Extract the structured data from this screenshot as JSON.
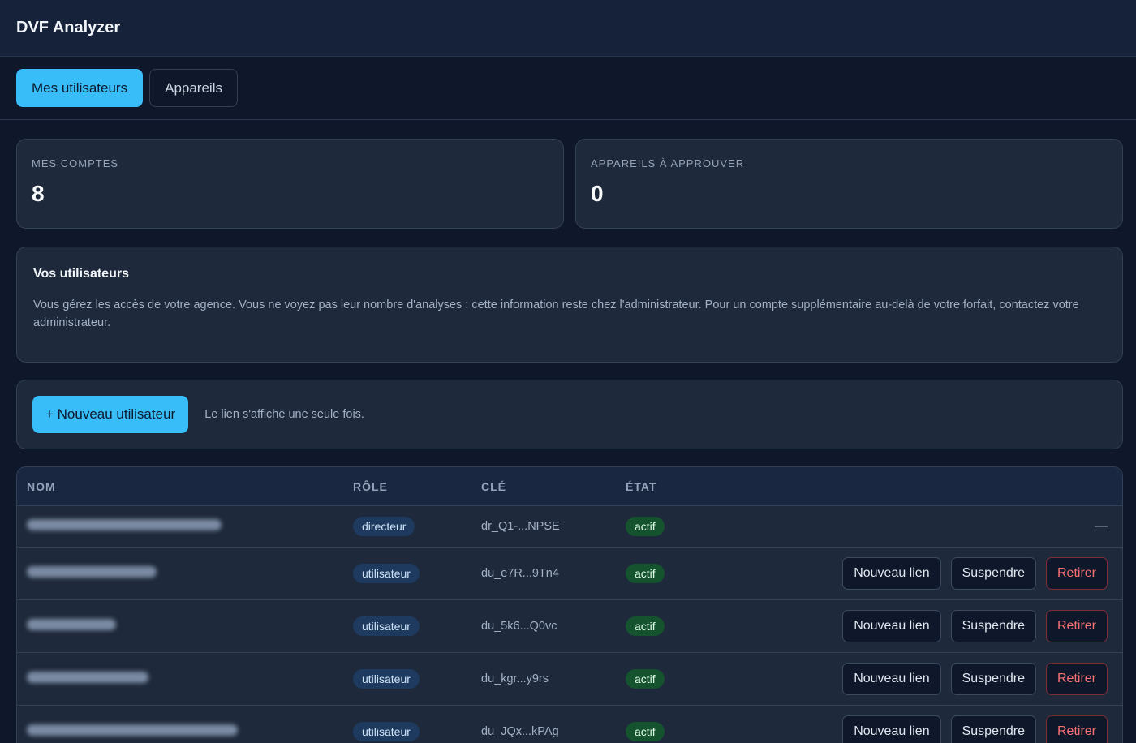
{
  "app": {
    "title": "DVF Analyzer"
  },
  "tabs": [
    {
      "label": "Mes utilisateurs",
      "active": true
    },
    {
      "label": "Appareils",
      "active": false
    }
  ],
  "stats": [
    {
      "label": "MES COMPTES",
      "value": "8"
    },
    {
      "label": "APPAREILS À APPROUVER",
      "value": "0"
    }
  ],
  "info": {
    "title": "Vos utilisateurs",
    "text": "Vous gérez les accès de votre agence. Vous ne voyez pas leur nombre d'analyses : cette information reste chez l'administrateur. Pour un compte supplémentaire au-delà de votre forfait, contactez votre administrateur."
  },
  "actions": {
    "new_user_label": "+ Nouveau utilisateur",
    "hint": "Le lien s'affiche une seule fois."
  },
  "table": {
    "headers": {
      "nom": "NOM",
      "role": "RÔLE",
      "cle": "CLÉ",
      "etat": "ÉTAT"
    },
    "buttons": {
      "new_link": "Nouveau lien",
      "suspend": "Suspendre",
      "remove": "Retirer"
    },
    "no_actions": "—",
    "rows": [
      {
        "role": "directeur",
        "key": "dr_Q1-...NPSE",
        "state": "actif"
      },
      {
        "role": "utilisateur",
        "key": "du_e7R...9Tn4",
        "state": "actif"
      },
      {
        "role": "utilisateur",
        "key": "du_5k6...Q0vc",
        "state": "actif"
      },
      {
        "role": "utilisateur",
        "key": "du_kgr...y9rs",
        "state": "actif"
      },
      {
        "role": "utilisateur",
        "key": "du_JQx...kPAg",
        "state": "actif"
      }
    ]
  }
}
